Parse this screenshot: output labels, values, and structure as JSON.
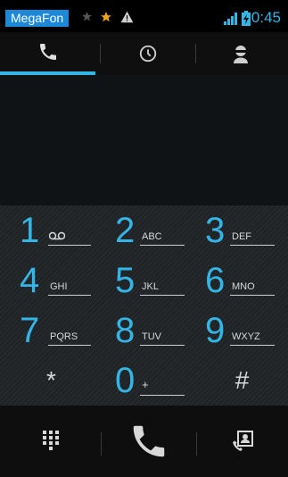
{
  "status_bar": {
    "carrier": "MegaFon",
    "time": "0:45",
    "icons": [
      "star-icon",
      "star-icon",
      "warning-icon",
      "signal-icon",
      "battery-charging-icon"
    ]
  },
  "tabs": [
    {
      "name": "phone",
      "icon": "phone-icon",
      "active": true
    },
    {
      "name": "recent",
      "icon": "clock-icon",
      "active": false
    },
    {
      "name": "contacts",
      "icon": "contact-icon",
      "active": false
    }
  ],
  "dialer": {
    "number": ""
  },
  "keypad": {
    "k1": {
      "digit": "1",
      "letters": ""
    },
    "k2": {
      "digit": "2",
      "letters": "ABC"
    },
    "k3": {
      "digit": "3",
      "letters": "DEF"
    },
    "k4": {
      "digit": "4",
      "letters": "GHI"
    },
    "k5": {
      "digit": "5",
      "letters": "JKL"
    },
    "k6": {
      "digit": "6",
      "letters": "MNO"
    },
    "k7": {
      "digit": "7",
      "letters": "PQRS"
    },
    "k8": {
      "digit": "8",
      "letters": "TUV"
    },
    "k9": {
      "digit": "9",
      "letters": "WXYZ"
    },
    "star": {
      "digit": "*"
    },
    "k0": {
      "digit": "0",
      "letters": "+"
    },
    "hash": {
      "digit": "#"
    }
  },
  "action_bar": {
    "icons": [
      "dialpad-icon",
      "call-icon",
      "add-contact-icon"
    ]
  },
  "colors": {
    "accent": "#33b5e5",
    "carrier_bg": "#1e88d8",
    "key_text": "#d8d8d8",
    "call_icon": "#d8d8d8"
  }
}
